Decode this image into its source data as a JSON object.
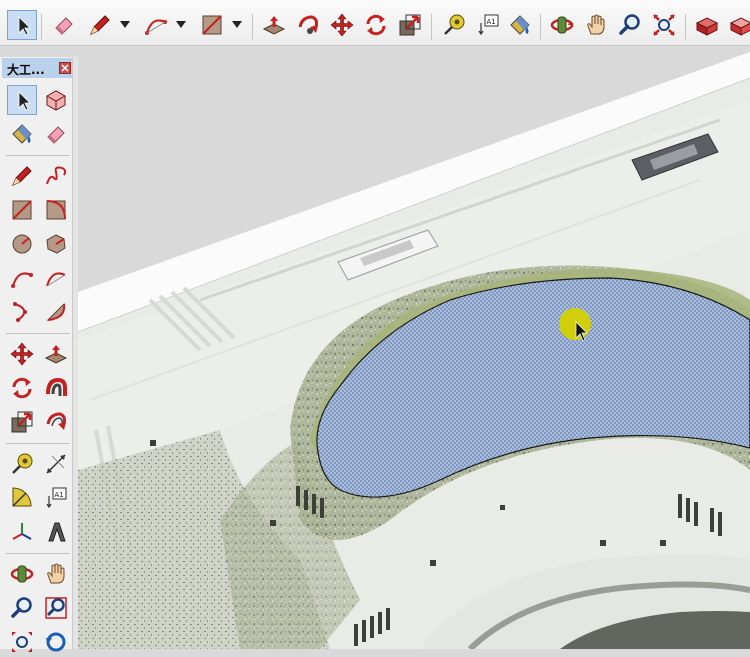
{
  "toolbar": {
    "tools": [
      {
        "name": "select-tool",
        "icon": "arrow-cursor-icon",
        "active": true
      },
      {
        "name": "eraser-tool",
        "icon": "eraser-icon"
      },
      {
        "name": "line-tool",
        "icon": "pencil-icon"
      },
      {
        "name": "arc-tool",
        "icon": "arc-icon"
      },
      {
        "name": "rectangle-tool",
        "icon": "rectangle-icon"
      },
      {
        "name": "push-pull-tool",
        "icon": "push-pull-icon"
      },
      {
        "name": "follow-me-tool",
        "icon": "follow-me-icon"
      },
      {
        "name": "move-tool",
        "icon": "move-icon"
      },
      {
        "name": "rotate-tool",
        "icon": "rotate-icon"
      },
      {
        "name": "scale-tool",
        "icon": "scale-icon"
      },
      {
        "name": "tape-measure-tool",
        "icon": "tape-measure-icon"
      },
      {
        "name": "text-tool",
        "icon": "text-label-icon"
      },
      {
        "name": "paint-bucket-tool",
        "icon": "paint-bucket-icon"
      },
      {
        "name": "orbit-tool",
        "icon": "orbit-icon"
      },
      {
        "name": "pan-tool",
        "icon": "hand-icon"
      },
      {
        "name": "zoom-tool",
        "icon": "magnifier-icon"
      },
      {
        "name": "zoom-extents-tool",
        "icon": "zoom-extents-icon"
      },
      {
        "name": "warehouse-tool",
        "icon": "warehouse-icon"
      },
      {
        "name": "extension-tool",
        "icon": "extension-icon"
      }
    ]
  },
  "palette": {
    "title": "大工...",
    "close_icon": "close-icon",
    "tools": [
      {
        "name": "select-tool",
        "icon": "arrow-cursor-icon",
        "active": true
      },
      {
        "name": "make-component-tool",
        "icon": "component-icon"
      },
      {
        "name": "paint-bucket-tool",
        "icon": "paint-bucket-icon"
      },
      {
        "name": "eraser-tool",
        "icon": "eraser-icon"
      },
      {
        "name": "line-tool",
        "icon": "pencil-icon"
      },
      {
        "name": "freehand-tool",
        "icon": "freehand-icon"
      },
      {
        "name": "rectangle-tool",
        "icon": "rectangle-icon"
      },
      {
        "name": "rotated-rectangle-tool",
        "icon": "rotated-rectangle-icon"
      },
      {
        "name": "circle-tool",
        "icon": "circle-icon"
      },
      {
        "name": "polygon-tool",
        "icon": "polygon-icon"
      },
      {
        "name": "arc-tool",
        "icon": "arc-icon"
      },
      {
        "name": "two-point-arc-tool",
        "icon": "two-point-arc-icon"
      },
      {
        "name": "three-point-arc-tool",
        "icon": "three-point-arc-icon"
      },
      {
        "name": "pie-tool",
        "icon": "pie-icon"
      },
      {
        "name": "move-tool",
        "icon": "move-icon"
      },
      {
        "name": "push-pull-tool",
        "icon": "push-pull-icon"
      },
      {
        "name": "rotate-tool",
        "icon": "rotate-icon"
      },
      {
        "name": "follow-me-tool",
        "icon": "follow-me-icon"
      },
      {
        "name": "scale-tool",
        "icon": "scale-icon"
      },
      {
        "name": "offset-tool",
        "icon": "offset-icon"
      },
      {
        "name": "tape-measure-tool",
        "icon": "tape-measure-icon"
      },
      {
        "name": "dimension-tool",
        "icon": "dimension-icon"
      },
      {
        "name": "protractor-tool",
        "icon": "protractor-icon"
      },
      {
        "name": "text-tool",
        "icon": "text-label-icon"
      },
      {
        "name": "axes-tool",
        "icon": "axes-icon"
      },
      {
        "name": "3d-text-tool",
        "icon": "3d-text-icon"
      },
      {
        "name": "orbit-tool",
        "icon": "orbit-icon"
      },
      {
        "name": "pan-tool",
        "icon": "hand-icon"
      },
      {
        "name": "zoom-tool",
        "icon": "magnifier-icon"
      },
      {
        "name": "zoom-window-tool",
        "icon": "zoom-window-icon"
      },
      {
        "name": "zoom-extents-tool",
        "icon": "zoom-extents-icon"
      },
      {
        "name": "previous-view-tool",
        "icon": "previous-view-icon"
      }
    ]
  },
  "text_label_glyph": "A1",
  "viewport": {
    "description_free": true,
    "selected_face_color": "#a8bedf",
    "highlight_color": "#d4d000"
  }
}
